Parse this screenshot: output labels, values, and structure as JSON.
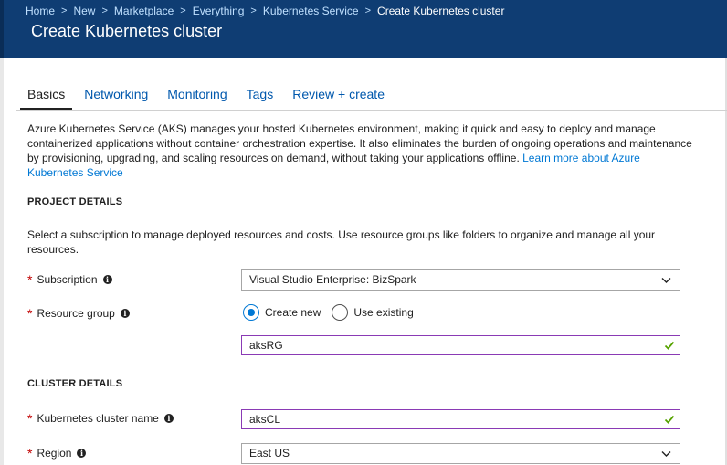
{
  "breadcrumb": {
    "items": [
      "Home",
      "New",
      "Marketplace",
      "Everything",
      "Kubernetes Service"
    ],
    "current": "Create Kubernetes cluster"
  },
  "page_title": "Create Kubernetes cluster",
  "tabs": [
    "Basics",
    "Networking",
    "Monitoring",
    "Tags",
    "Review + create"
  ],
  "active_tab": "Basics",
  "intro": {
    "text": "Azure Kubernetes Service (AKS) manages your hosted Kubernetes environment, making it quick and easy to deploy and manage containerized applications without container orchestration expertise. It also eliminates the burden of ongoing operations and maintenance by provisioning, upgrading, and scaling resources on demand, without taking your applications offline. ",
    "link": "Learn more about Azure Kubernetes Service"
  },
  "project": {
    "heading": "PROJECT DETAILS",
    "description": "Select a subscription to manage deployed resources and costs. Use resource groups like folders to organize and manage all your resources.",
    "subscription_label": "Subscription",
    "subscription_value": "Visual Studio Enterprise: BizSpark",
    "resource_group_label": "Resource group",
    "radio_create_new": "Create new",
    "radio_use_existing": "Use existing",
    "resource_group_value": "aksRG"
  },
  "cluster": {
    "heading": "CLUSTER DETAILS",
    "name_label": "Kubernetes cluster name",
    "name_value": "aksCL",
    "region_label": "Region",
    "region_value": "East US"
  },
  "required_marker": "*",
  "info_glyph": "i",
  "colors": {
    "header_bg": "#0f3d73",
    "link": "#0078d4",
    "valid_border": "#8a3ab5",
    "valid_check": "#57a300",
    "required": "#c10000"
  }
}
